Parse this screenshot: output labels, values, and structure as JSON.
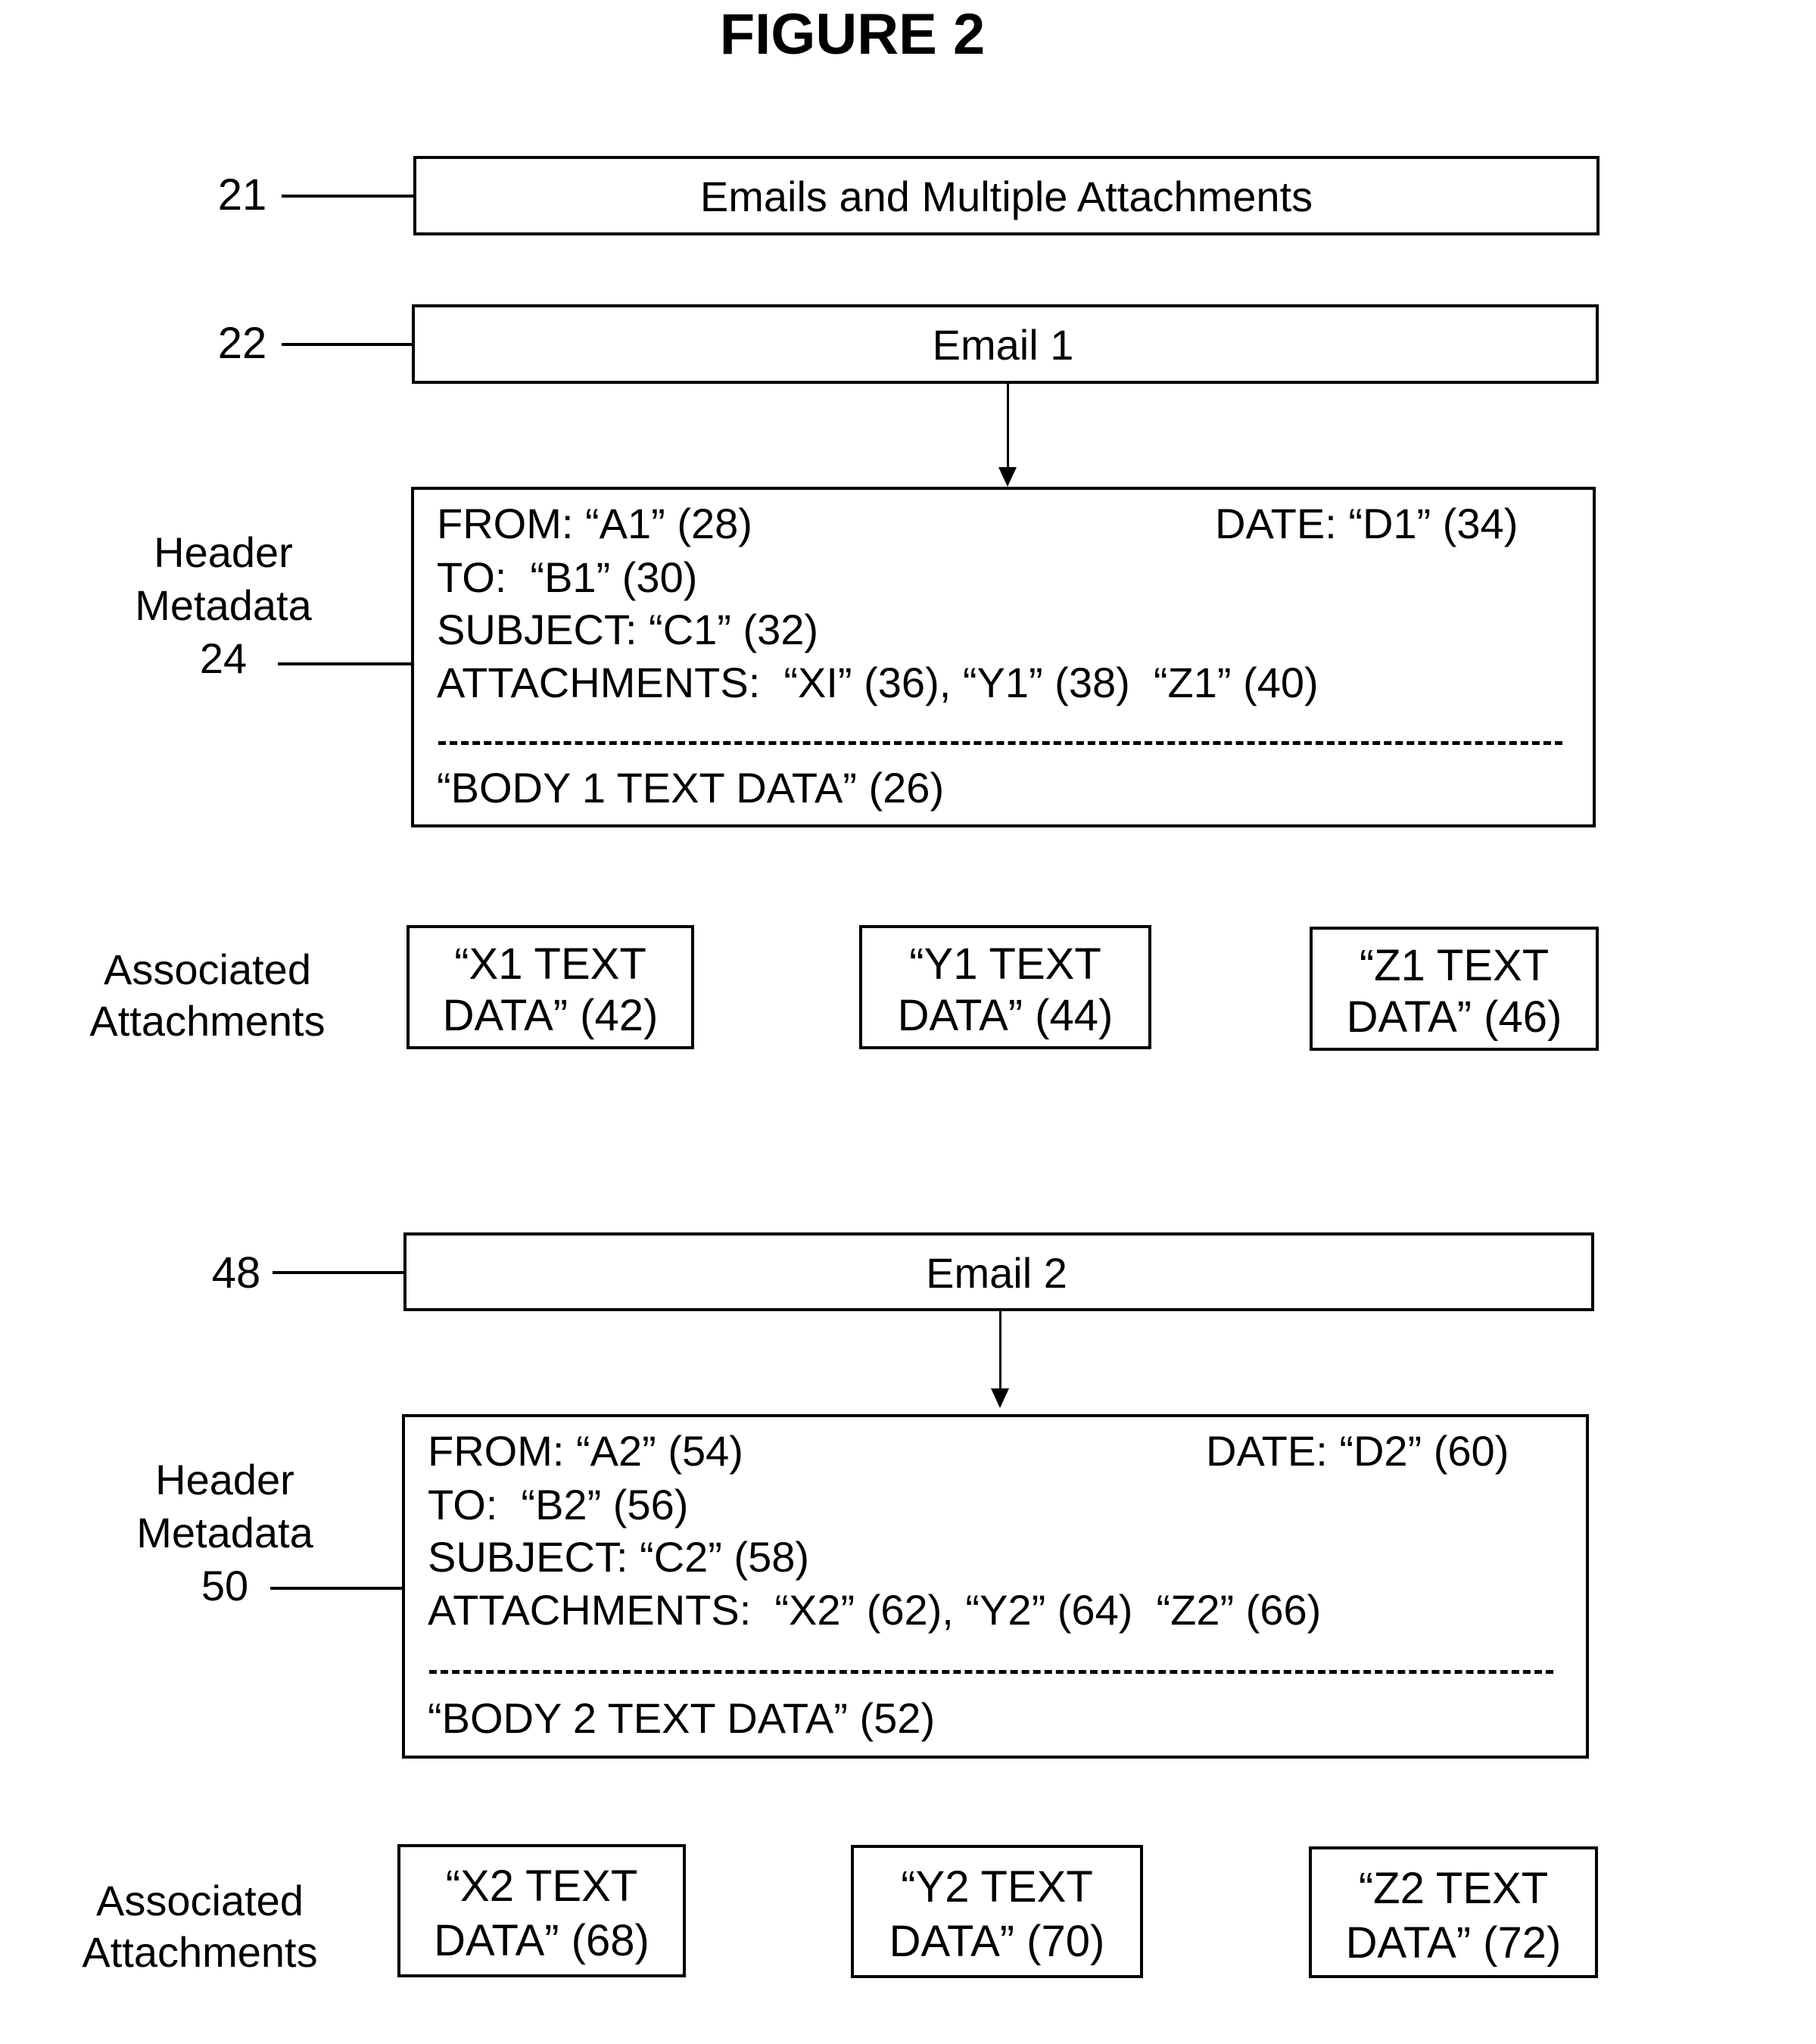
{
  "figure": {
    "title": "FIGURE 2"
  },
  "collection": {
    "ref": "21",
    "label": "Emails and Multiple Attachments"
  },
  "emails": [
    {
      "ref": "22",
      "label": "Email 1",
      "header_side_label": [
        "Header",
        "Metadata",
        "24"
      ],
      "header": {
        "from": "FROM: “A1” (28)",
        "date": "DATE: “D1” (34)",
        "to": "TO:  “B1” (30)",
        "subject": "SUBJECT: “C1” (32)",
        "attachments": "ATTACHMENTS:  “XI” (36), “Y1” (38)  “Z1” (40)",
        "body": "“BODY 1 TEXT DATA” (26)"
      },
      "attachments_side_label": [
        "Associated",
        "Attachments"
      ],
      "attachments": [
        {
          "line1": "“X1 TEXT",
          "line2": "DATA” (42)"
        },
        {
          "line1": "“Y1 TEXT",
          "line2": "DATA” (44)"
        },
        {
          "line1": "“Z1 TEXT",
          "line2": "DATA” (46)"
        }
      ]
    },
    {
      "ref": "48",
      "label": "Email 2",
      "header_side_label": [
        "Header",
        "Metadata",
        "50"
      ],
      "header": {
        "from": "FROM: “A2” (54)",
        "date": "DATE: “D2” (60)",
        "to": "TO:  “B2” (56)",
        "subject": "SUBJECT: “C2” (58)",
        "attachments": "ATTACHMENTS:  “X2” (62), “Y2” (64)  “Z2” (66)",
        "body": "“BODY 2 TEXT DATA” (52)"
      },
      "attachments_side_label": [
        "Associated",
        "Attachments"
      ],
      "attachments": [
        {
          "line1": "“X2 TEXT",
          "line2": "DATA” (68)"
        },
        {
          "line1": "“Y2 TEXT",
          "line2": "DATA” (70)"
        },
        {
          "line1": "“Z2 TEXT",
          "line2": "DATA” (72)"
        }
      ]
    }
  ]
}
